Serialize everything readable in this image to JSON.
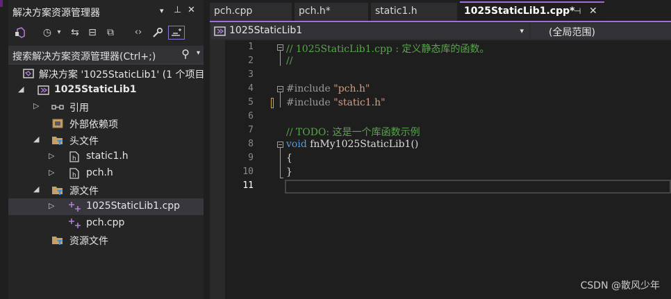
{
  "solution_explorer": {
    "title": "解决方案资源管理器",
    "title_buttons": [
      "▾",
      "⊥",
      "✕"
    ],
    "toolbar_glyphs": [
      "⇋",
      "◷",
      "⇆",
      "⊟",
      "⧉",
      "‹›",
      "🔧",
      "⍈"
    ],
    "search_placeholder": "搜索解决方案资源管理器(Ctrl+;)",
    "search_glyph": "⚲",
    "tree": {
      "solution": "解决方案 '1025StaticLib1' (1 个项目",
      "project": "1025StaticLib1",
      "references": "引用",
      "external_deps": "外部依赖项",
      "headers": "头文件",
      "static1_h": "static1.h",
      "pch_h": "pch.h",
      "sources": "源文件",
      "main_cpp": "1025StaticLib1.cpp",
      "pch_cpp": "pch.cpp",
      "resources": "资源文件"
    }
  },
  "tabs": [
    {
      "label": "pch.cpp"
    },
    {
      "label": "pch.h*"
    },
    {
      "label": "static1.h"
    },
    {
      "label": "1025StaticLib1.cpp*",
      "pin": "⊣",
      "close": "✕"
    }
  ],
  "navbar": {
    "project": "1025StaticLib1",
    "scope": "(全局范围)",
    "dropdown": "▾"
  },
  "code": {
    "line_numbers": [
      "1",
      "2",
      "3",
      "4",
      "5",
      "6",
      "7",
      "8",
      "9",
      "10",
      "11"
    ],
    "l1": "// 1025StaticLib1.cpp : 定义静态库的函数。",
    "l2": "//",
    "l4_pp": "#include ",
    "l4_str": "\"pch.h\"",
    "l5_pp": "#include ",
    "l5_str": "\"static1.h\"",
    "l7": "// TODO: 这是一个库函数示例",
    "l8_kw": "void",
    "l8_rest": " fnMy1025StaticLib1()",
    "l9": "{",
    "l10": "}"
  },
  "watermark": "CSDN @散风少年",
  "colors": {
    "accent": "#9d6fd8",
    "comment": "#57a64a",
    "keyword": "#569cd6",
    "string": "#d69d85",
    "preprocessor": "#9b9b9b"
  }
}
